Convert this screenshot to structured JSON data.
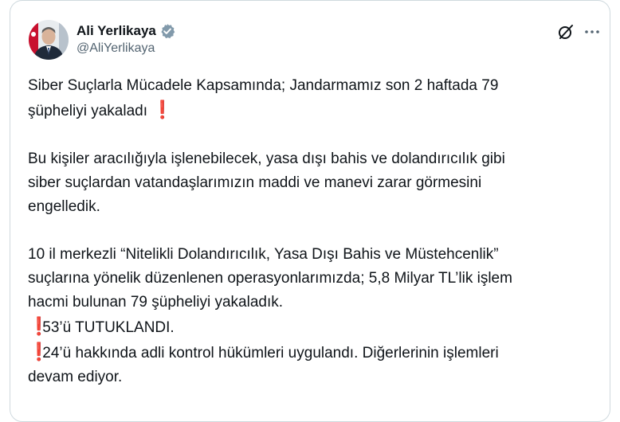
{
  "author": {
    "display_name": "Ali Yerlikaya",
    "handle": "@AliYerlikaya",
    "verified_icon": "verified-badge-icon",
    "avatar_icon": "profile-photo"
  },
  "actions": {
    "grok_icon": "grok-icon",
    "more_icon": "more-options-icon"
  },
  "tweet": {
    "p1_line1": "Siber Suçlarla Mücadele Kapsamında; Jandarmamız son 2 haftada 79",
    "p1_line2": "şüpheliyi yakaladı",
    "p2_line1": "Bu kişiler aracılığıyla işlenebilecek, yasa dışı bahis ve dolandırıcılık gibi",
    "p2_line2": "siber suçlardan vatandaşlarımızın maddi ve manevi zarar görmesini",
    "p2_line3": "engelledik.",
    "p3_line1": "10 il merkezli “Nitelikli Dolandırıcılık, Yasa Dışı Bahis ve Müstehcenlik”",
    "p3_line2": "suçlarına yönelik düzenlenen operasyonlarımızda; 5,8 Milyar TL’lik işlem",
    "p3_line3": "hacmi bulunan 79 şüpheliyi yakaladık.",
    "p3_line4": "53’ü TUTUKLANDI.",
    "p3_line5": "24’ü hakkında adli kontrol hükümleri uygulandı. Diğerlerinin işlemleri",
    "p3_line6": "devam ediyor.",
    "emoji": "❗",
    "emoji_color": "#d42a2a"
  },
  "colors": {
    "text": "#0f1419",
    "secondary": "#536471",
    "verified": "#829aab",
    "border": "#cfd9de"
  }
}
